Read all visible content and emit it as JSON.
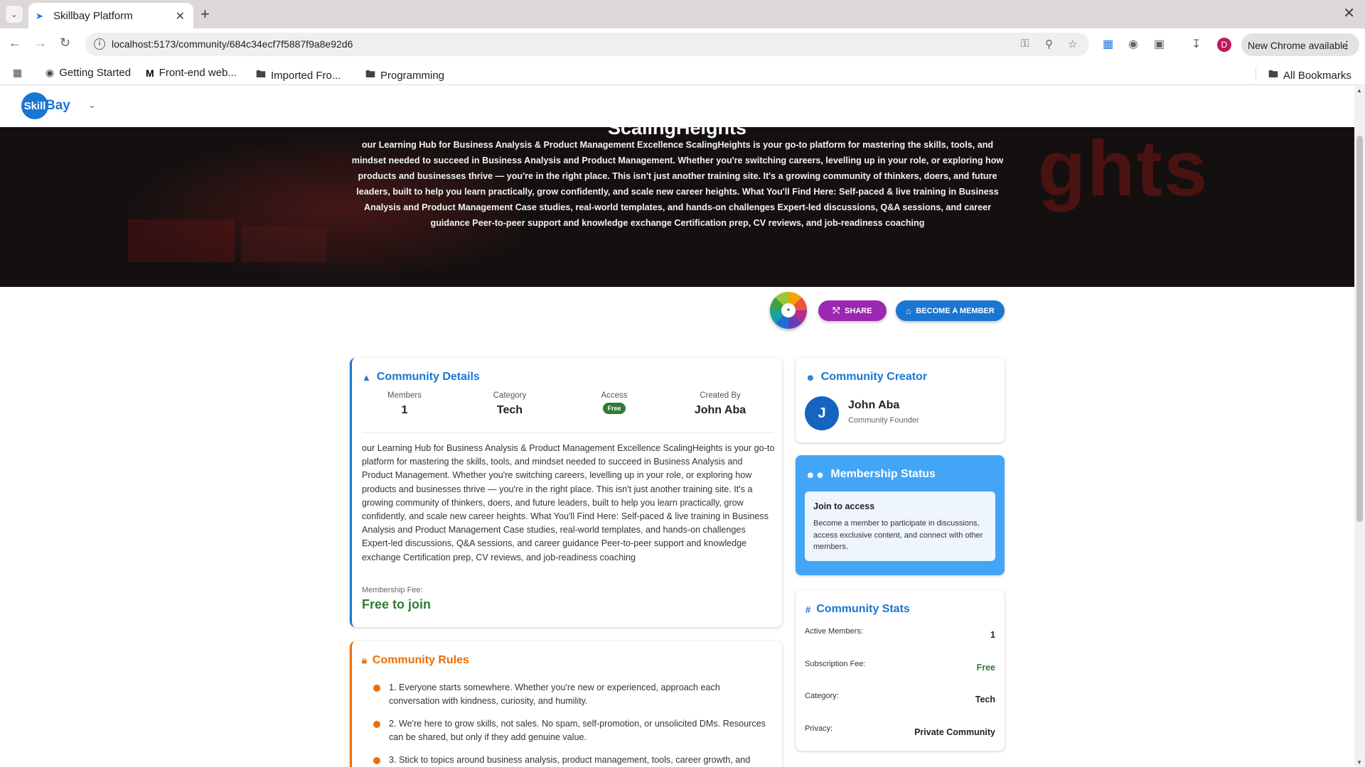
{
  "browser": {
    "tab_title": "Skillbay Platform",
    "url": "localhost:5173/community/684c34ecf7f5887f9a8e92d6",
    "update_label": "New Chrome available",
    "profile_initial": "D",
    "bookmarks": [
      {
        "label": "Getting Started",
        "icon": "globe-icon"
      },
      {
        "label": "Front-end web...",
        "icon": "m-icon"
      },
      {
        "label": "Imported Fro...",
        "icon": "folder-icon"
      },
      {
        "label": "Programming",
        "icon": "folder-icon"
      }
    ],
    "all_bookmarks": "All Bookmarks"
  },
  "app": {
    "logo_left": "Skill",
    "logo_right": "Bay"
  },
  "hero": {
    "title": "ScalingHeights",
    "description": "our Learning Hub for Business Analysis & Product Management Excellence ScalingHeights is your go-to platform for mastering the skills, tools, and mindset needed to succeed in Business Analysis and Product Management. Whether you're switching careers, levelling up in your role, or exploring how products and businesses thrive — you're in the right place. This isn't just another training site. It's a growing community of thinkers, doers, and future leaders, built to help you learn practically, grow confidently, and scale new career heights. What You'll Find Here: Self-paced & live training in Business Analysis and Product Management Case studies, real-world templates, and hands-on challenges Expert-led discussions, Q&A sessions, and career guidance Peer-to-peer support and knowledge exchange Certification prep, CV reviews, and job-readiness coaching",
    "backdrop_text": "ghts"
  },
  "actions": {
    "share": "SHARE",
    "become_member": "BECOME A MEMBER"
  },
  "details": {
    "heading": "Community Details",
    "stats": [
      {
        "label": "Members",
        "value": "1"
      },
      {
        "label": "Category",
        "value": "Tech"
      },
      {
        "label": "Access",
        "value": "Free"
      },
      {
        "label": "Created By",
        "value": "John Aba"
      }
    ],
    "body": "our Learning Hub for Business Analysis & Product Management Excellence ScalingHeights is your go-to platform for mastering the skills, tools, and mindset needed to succeed in Business Analysis and Product Management. Whether you're switching careers, levelling up in your role, or exploring how products and businesses thrive — you're in the right place. This isn't just another training site. It's a growing community of thinkers, doers, and future leaders, built to help you learn practically, grow confidently, and scale new career heights. What You'll Find Here: Self-paced & live training in Business Analysis and Product Management Case studies, real-world templates, and hands-on challenges Expert-led discussions, Q&A sessions, and career guidance Peer-to-peer support and knowledge exchange Certification prep, CV reviews, and job-readiness coaching",
    "fee_label": "Membership Fee:",
    "fee_value": "Free to join"
  },
  "rules": {
    "heading": "Community Rules",
    "items": [
      "1. Everyone starts somewhere. Whether you're new or experienced, approach each conversation with kindness, curiosity, and humility.",
      "2. We're here to grow skills, not sales. No spam, self-promotion, or unsolicited DMs. Resources can be shared, but only if they add genuine value.",
      "3. Stick to topics around business analysis, product management, tools, career growth, and"
    ]
  },
  "creator": {
    "heading": "Community Creator",
    "initial": "J",
    "name": "John Aba",
    "role": "Community Founder"
  },
  "membership": {
    "heading": "Membership Status",
    "title": "Join to access",
    "text": "Become a member to participate in discussions, access exclusive content, and connect with other members."
  },
  "stats": {
    "heading": "Community Stats",
    "rows": [
      {
        "label": "Active Members:",
        "value": "1"
      },
      {
        "label": "Subscription Fee:",
        "value": "Free"
      },
      {
        "label": "Category:",
        "value": "Tech"
      },
      {
        "label": "Privacy:",
        "value": "Private Community"
      }
    ]
  },
  "colors": {
    "primary": "#1976d2",
    "share": "#9c27b0",
    "rules_accent": "#ef6c00",
    "success": "#2e7d32",
    "membership_bg": "#42a5f5"
  }
}
